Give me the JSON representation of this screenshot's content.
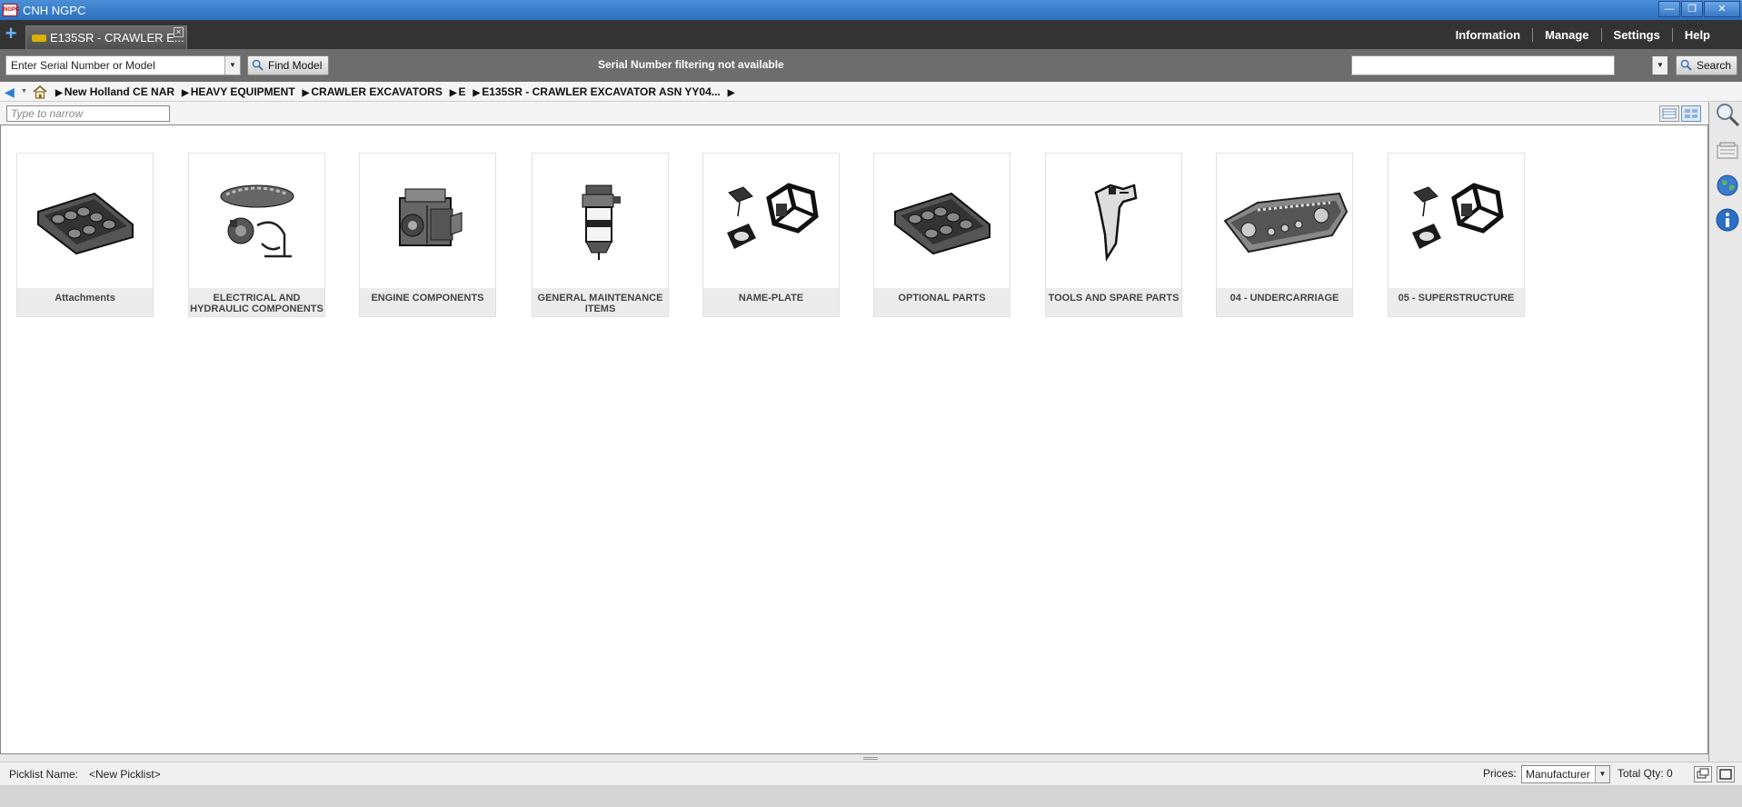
{
  "window": {
    "logo_text": "NGPC",
    "title": "CNH NGPC",
    "controls": [
      "minimize",
      "restore",
      "close"
    ]
  },
  "tabs": [
    {
      "label": "E135SR - CRAWLER E...",
      "icon": "machine-icon"
    }
  ],
  "top_nav": [
    "Information",
    "Manage",
    "Settings",
    "Help"
  ],
  "search_row": {
    "serial_placeholder": "Enter Serial Number or Model",
    "find_model_label": "Find Model",
    "filter_status": "Serial Number filtering not available",
    "search_value": "",
    "search_label": "Search"
  },
  "breadcrumb": [
    "New Holland CE NAR",
    "HEAVY EQUIPMENT",
    "CRAWLER EXCAVATORS",
    "E",
    "E135SR - CRAWLER EXCAVATOR ASN YY04..."
  ],
  "filter": {
    "placeholder": "Type to narrow"
  },
  "categories": [
    {
      "label": "Attachments",
      "icon": "track-attachment-icon"
    },
    {
      "label": "ELECTRICAL AND HYDRAULIC COMPONENTS",
      "icon": "electrical-hydraulic-icon"
    },
    {
      "label": "ENGINE COMPONENTS",
      "icon": "engine-icon"
    },
    {
      "label": "GENERAL MAINTENANCE ITEMS",
      "icon": "filter-icon"
    },
    {
      "label": "NAME-PLATE",
      "icon": "nameplate-icon"
    },
    {
      "label": "OPTIONAL PARTS",
      "icon": "track-attachment-icon"
    },
    {
      "label": "TOOLS AND SPARE PARTS",
      "icon": "ripper-tool-icon"
    },
    {
      "label": "04 - UNDERCARRIAGE",
      "icon": "undercarriage-icon"
    },
    {
      "label": "05 - SUPERSTRUCTURE",
      "icon": "nameplate-icon"
    }
  ],
  "bottom": {
    "picklist_label": "Picklist Name:",
    "picklist_value": "<New Picklist>",
    "prices_label": "Prices:",
    "prices_value": "Manufacturer",
    "total_qty": "Total Qty: 0"
  }
}
